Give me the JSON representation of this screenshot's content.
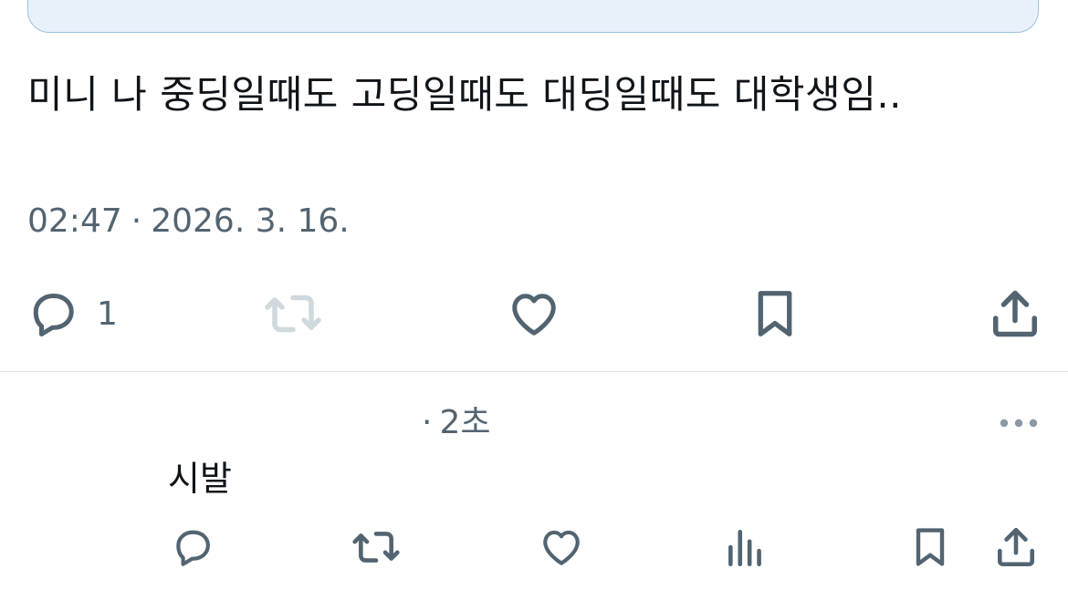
{
  "tweet": {
    "text": "미니 나 중딩일때도 고딩일때도 대딩일때도 대학생임..",
    "time": "02:47",
    "separator": "·",
    "date": "2026. 3. 16.",
    "reply_count": "1",
    "icons": [
      "reply-icon",
      "retweet-icon",
      "like-icon",
      "bookmark-icon",
      "share-icon"
    ],
    "retweet_disabled": true
  },
  "reply": {
    "meta_separator": "·",
    "time_ago": "2초",
    "text": "시발",
    "icons": [
      "reply-icon",
      "retweet-icon",
      "like-icon",
      "views-icon",
      "bookmark-icon",
      "share-icon",
      "more-icon"
    ]
  },
  "colors": {
    "text": "#0f1419",
    "muted": "#536471",
    "disabled": "#cfd9de",
    "quote_bg": "#e8f1fa",
    "quote_border": "#9cc0e0",
    "divider": "#dfe3e6"
  }
}
